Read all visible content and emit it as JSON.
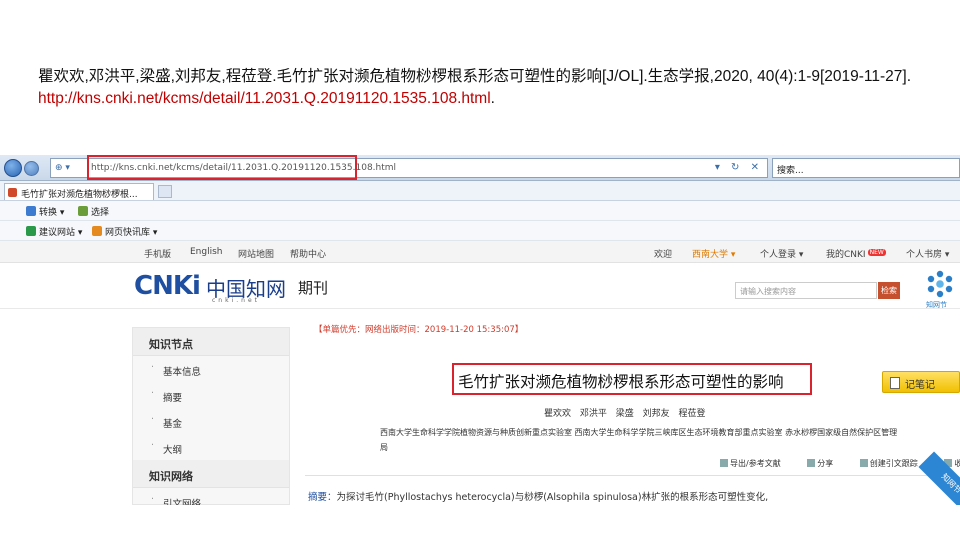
{
  "citation": {
    "text": "瞿欢欢,邓洪平,梁盛,刘邦友,程莅登.毛竹扩张对濒危植物桫椤根系形态可塑性的影响[J/OL].生态学报,2020, 40(4):1-9[2019-11-27].",
    "url": "http://kns.cnki.net/kcms/detail/11.2031.Q.20191120.1535.108.html",
    "trail": "."
  },
  "browser": {
    "address": "http://kns.cnki.net/kcms/detail/11.2031.Q.20191120.1535.108.html",
    "search_placeholder": "搜索...",
    "tab_title": "毛竹扩张对濒危植物桫椤根...",
    "cmd_row1": [
      "转换",
      "选择"
    ],
    "cmd_row2": [
      "建议网站",
      "网页快讯库"
    ]
  },
  "cnki_nav": {
    "left": [
      "手机版",
      "English",
      "网站地图",
      "帮助中心"
    ],
    "right": [
      "欢迎",
      "西南大学",
      "个人登录",
      "我的CNKI",
      "个人书房"
    ],
    "new_badge": "NEW"
  },
  "header": {
    "logo": "CNKi",
    "logo_cn": "中国知网",
    "logo_sub": "cnki.net",
    "channel": "期刊",
    "search_placeholder": "请输入搜索内容",
    "search_button": "检索",
    "brand_label": "知网节"
  },
  "sidebar": {
    "section1_title": "知识节点",
    "section1_items": [
      "基本信息",
      "摘要",
      "基金",
      "大纲"
    ],
    "section2_title": "知识网络",
    "section2_items": [
      "引文网络"
    ]
  },
  "article": {
    "pub_line": "【单篇优先：网络出版时间：2019-11-20 15:35:07】",
    "title": "毛竹扩张对濒危植物桫椤根系形态可塑性的影响",
    "note_button": "记笔记",
    "authors": "瞿欢欢 邓洪平 梁盛 刘邦友 程莅登",
    "affiliation": "西南大学生命科学学院植物资源与种质创新重点实验室 西南大学生命科学学院三峡库区生态环境教育部重点实验室 赤水桫椤国家级自然保护区管理局",
    "actions": [
      "导出/参考文献",
      "分享",
      "创建引文跟踪",
      "收藏",
      "打印"
    ],
    "abstract_label": "摘要：",
    "abstract": "为探讨毛竹(Phyllostachys heterocycla)与桫椤(Alsophila spinulosa)林扩张的根系形态可塑性变化,",
    "ribbon": "知网节"
  },
  "colors": {
    "highlight": "#d9232e",
    "url": "#c00000",
    "cnki_blue": "#1f4fa0",
    "note_yellow": "#f0c000"
  }
}
